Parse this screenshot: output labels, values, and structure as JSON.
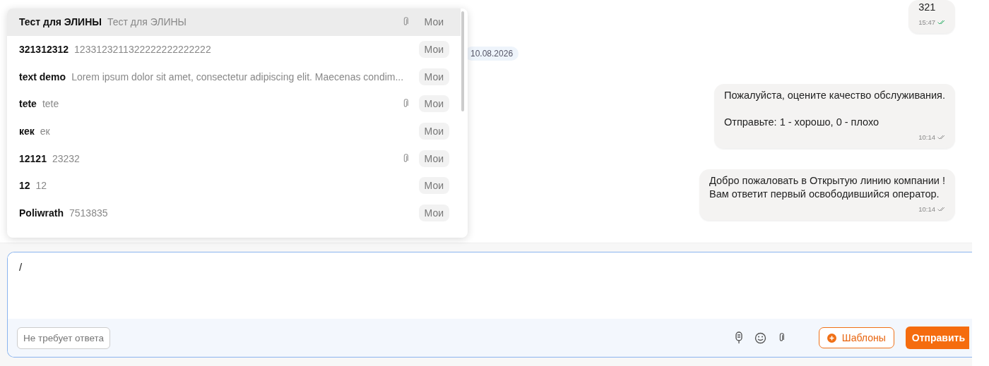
{
  "templates": [
    {
      "title": "Тест для ЭЛИНЫ",
      "text": "Тест для ЭЛИНЫ",
      "attachment": true,
      "tag": "Мои",
      "selected": true
    },
    {
      "title": "321312312",
      "text": "1233123211322222222222222",
      "attachment": false,
      "tag": "Мои",
      "selected": false
    },
    {
      "title": "text demo",
      "text": "Lorem ipsum dolor sit amet, consectetur adipiscing elit. Maecenas condim...",
      "attachment": false,
      "tag": "Мои",
      "selected": false
    },
    {
      "title": "tete",
      "text": "tete",
      "attachment": true,
      "tag": "Мои",
      "selected": false
    },
    {
      "title": "кек",
      "text": "ек",
      "attachment": false,
      "tag": "Мои",
      "selected": false
    },
    {
      "title": "12121",
      "text": "23232",
      "attachment": true,
      "tag": "Мои",
      "selected": false
    },
    {
      "title": "12",
      "text": "12",
      "attachment": false,
      "tag": "Мои",
      "selected": false
    },
    {
      "title": "Poliwrath",
      "text": "7513835",
      "attachment": false,
      "tag": "Мои",
      "selected": false
    }
  ],
  "messages": [
    {
      "kind": "message",
      "lines": [
        "321"
      ],
      "time": "15:47",
      "read": true
    },
    {
      "kind": "date",
      "text": "10.08.2026"
    },
    {
      "kind": "message",
      "lines": [
        "Пожалуйста, оцените качество обслуживания.",
        "Отправьте: 1 - хорошо, 0 - плохо"
      ],
      "paragraph_breaks": true,
      "time": "10:14",
      "read": false
    },
    {
      "kind": "message",
      "lines": [
        "Добро пожаловать в Открытую линию компании !",
        "Вам ответит первый освободившийся оператор."
      ],
      "time": "10:14",
      "read": false
    }
  ],
  "composer": {
    "value": "/",
    "no_reply_button": "Не требует ответа",
    "templates_button": "Шаблоны",
    "send_button": "Отправить"
  }
}
